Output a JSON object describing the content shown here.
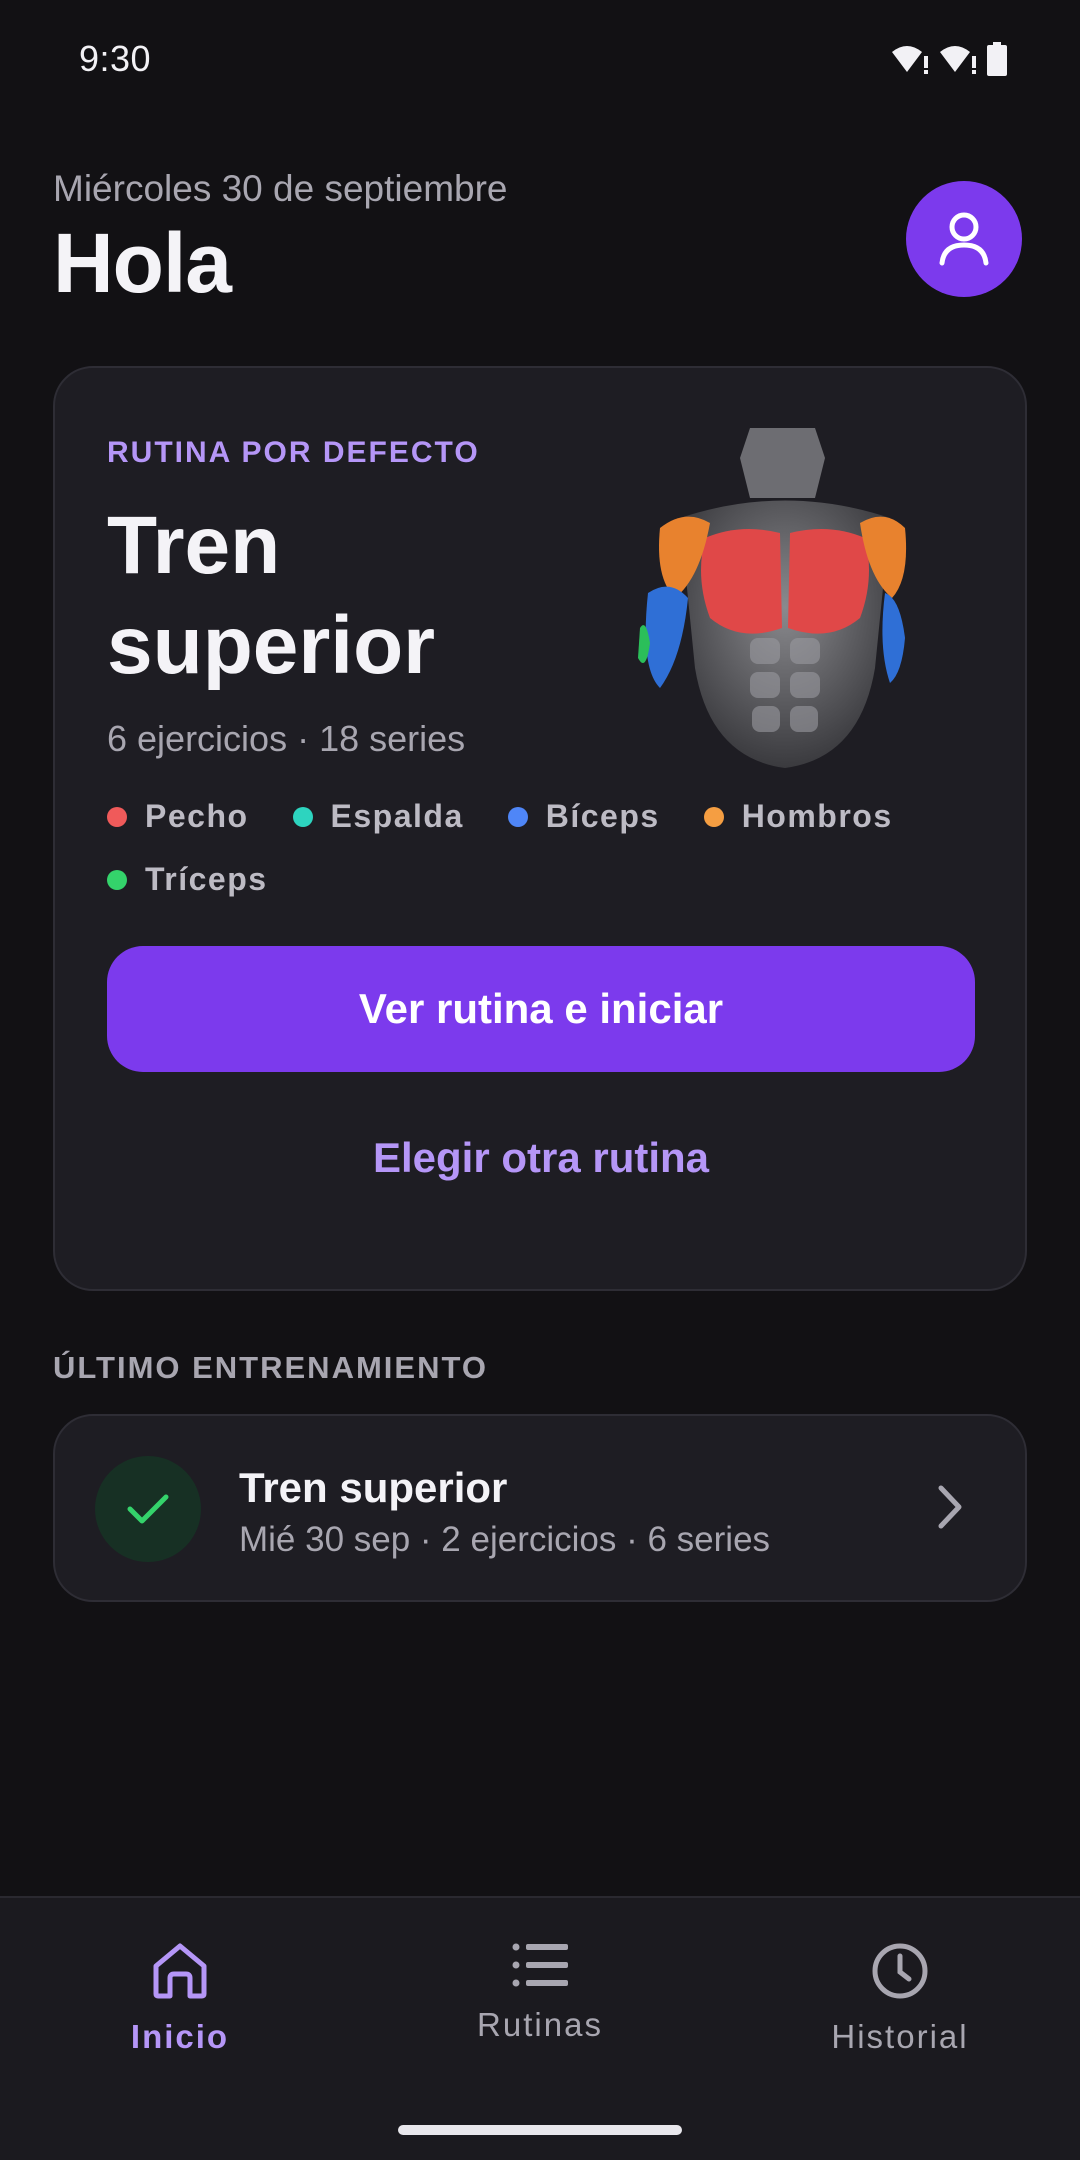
{
  "status_bar": {
    "time": "9:30"
  },
  "header": {
    "date": "Miércoles 30 de septiembre",
    "greeting": "Hola"
  },
  "routine_card": {
    "eyebrow": "RUTINA POR DEFECTO",
    "title_line1": "Tren",
    "title_line2": "superior",
    "meta": "6 ejercicios · 18 series",
    "muscles": [
      {
        "label": "Pecho",
        "color": "#f05a5a"
      },
      {
        "label": "Espalda",
        "color": "#2dd4bf"
      },
      {
        "label": "Bíceps",
        "color": "#4f86f7"
      },
      {
        "label": "Hombros",
        "color": "#f59e42"
      },
      {
        "label": "Tríceps",
        "color": "#34d36b"
      }
    ],
    "primary_button": "Ver rutina e iniciar",
    "secondary_button": "Elegir otra rutina"
  },
  "last_workout": {
    "section_label": "ÚLTIMO ENTRENAMIENTO",
    "title": "Tren superior",
    "meta": "Mié 30 sep · 2 ejercicios · 6 series"
  },
  "bottom_nav": {
    "items": [
      {
        "label": "Inicio",
        "icon": "home-icon",
        "active": true
      },
      {
        "label": "Rutinas",
        "icon": "list-icon",
        "active": false
      },
      {
        "label": "Historial",
        "icon": "clock-icon",
        "active": false
      }
    ]
  },
  "colors": {
    "background": "#121114",
    "card": "#1e1d23",
    "accent": "#7c3aed",
    "accent_light": "#b596f7",
    "success": "#34d36b"
  }
}
